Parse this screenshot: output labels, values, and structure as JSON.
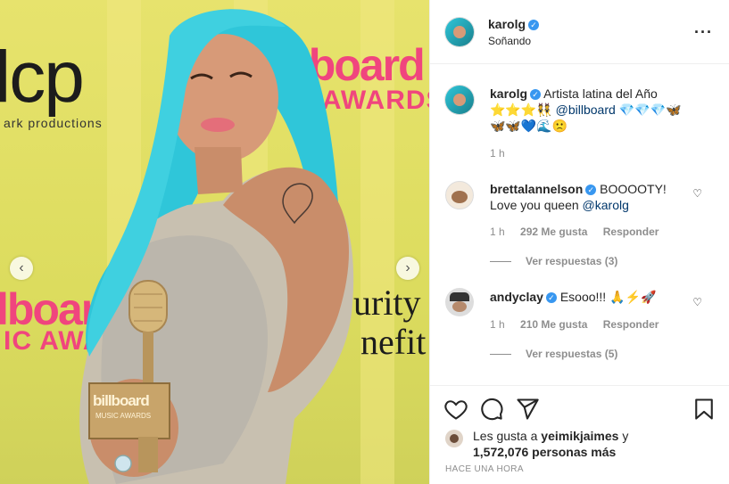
{
  "photo": {
    "bg_texts": {
      "lcp": "lcp",
      "productions": "ark productions",
      "billboard_top": "llboard",
      "awards_top": "C AWARDS",
      "billboard_bottom": "lboard",
      "awards_bottom": "IC AWA",
      "security": "urity",
      "benefit": "nefit"
    },
    "trophy_text": "billboard",
    "trophy_sub": "MUSIC AWARDS",
    "prev_icon": "chevron-left-icon",
    "next_icon": "chevron-right-icon"
  },
  "header": {
    "username": "karolg",
    "location": "Soñando",
    "more_icon": "more-options-icon"
  },
  "caption": {
    "username": "karolg",
    "text_start": "Artista latina del Año",
    "line2_emojis": "⭐⭐⭐👯",
    "mention": "@billboard",
    "line2_tail": "💎💎💎🦋",
    "line3": "🦋🦋💙🌊🙁",
    "time": "1 h"
  },
  "comments": [
    {
      "username": "brettalannelson",
      "text": "BOOOOTY!",
      "text2": "Love you queen",
      "mention": "@karolg",
      "time": "1 h",
      "likes": "292 Me gusta",
      "reply": "Responder",
      "view_replies": "Ver respuestas (3)"
    },
    {
      "username": "andyclay",
      "text": "Esooo!!! 🙏⚡🚀",
      "time": "1 h",
      "likes": "210 Me gusta",
      "reply": "Responder",
      "view_replies": "Ver respuestas (5)"
    }
  ],
  "actions": {
    "like_icon": "heart-icon",
    "comment_icon": "comment-icon",
    "share_icon": "share-icon",
    "save_icon": "bookmark-icon"
  },
  "likes": {
    "prefix": "Les gusta a",
    "user": "yeimikjaimes",
    "connector": "y",
    "count": "1,572,076 personas más"
  },
  "time_ago": "HACE UNA HORA",
  "colors": {
    "verified": "#3897f0",
    "hair": "#2fc6d9",
    "billboard_pink": "#f0457e",
    "backdrop": "#e3e06a"
  }
}
